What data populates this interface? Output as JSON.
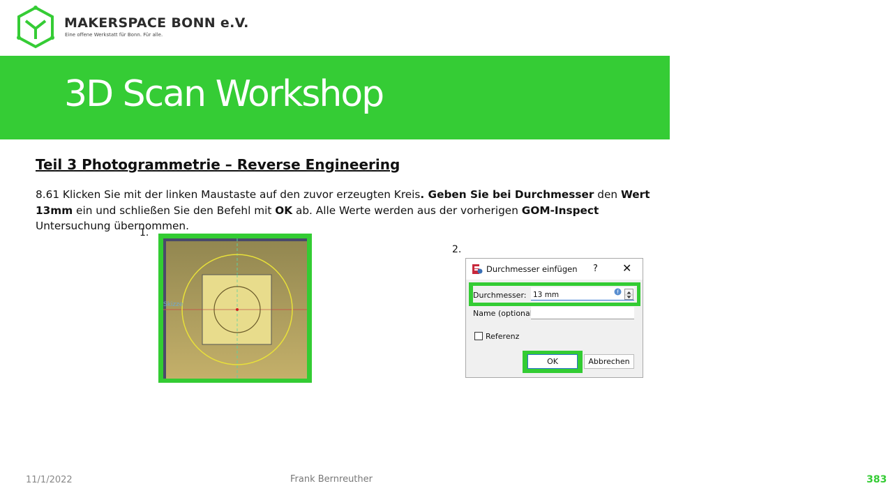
{
  "brand": {
    "name": "MAKERSPACE BONN e.V.",
    "tagline": "Eine offene Werkstatt für Bonn. Für alle.",
    "accent_color": "#35cc35",
    "logo_icon": "hexagon-m-logo"
  },
  "banner": {
    "title": "3D Scan Workshop"
  },
  "content": {
    "heading": "Teil 3  Photogrammetrie  – Reverse Engineering",
    "instruction": {
      "p1": "8.61 Klicken Sie mit der linken Maustaste auf den zuvor erzeugten Kreis",
      "p2": ". Geben Sie bei ",
      "b1": "Durchmesser",
      "p3": " den ",
      "b2": "Wert 13mm",
      "p4": " ein und schließen Sie den Befehl mit ",
      "b3": "OK",
      "p5": " ab. Alle Werte werden aus der vorherigen ",
      "b4": "GOM-Inspect",
      "p6": " Untersuchung übernommen."
    },
    "step1_label": "1.",
    "step2_label": "2.",
    "cad_overlay_text": "Skizze"
  },
  "dialog": {
    "title": "Durchmesser einfügen",
    "help_label": "?",
    "close_label": "✕",
    "durchmesser_label": "Durchmesser:",
    "durchmesser_value": "13 mm",
    "name_label": "Name (optional)",
    "name_value": "",
    "referenz_label": "Referenz",
    "referenz_checked": false,
    "ok_label": "OK",
    "cancel_label": "Abbrechen"
  },
  "footer": {
    "date": "11/1/2022",
    "author": "Frank Bernreuther",
    "page_number": "383"
  }
}
